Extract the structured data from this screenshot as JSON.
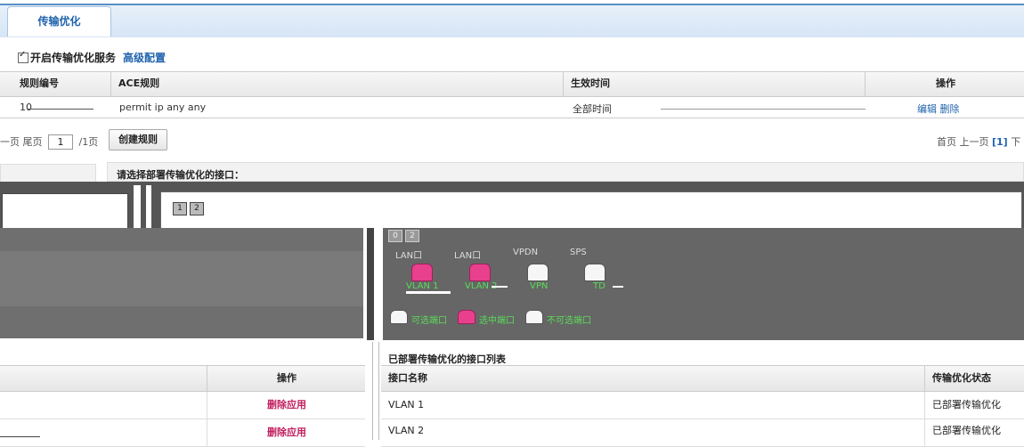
{
  "tabs": [
    {
      "label": "传输优化"
    }
  ],
  "service": {
    "checkbox_label": "开启传输优化服务",
    "advanced_link": "高级配置"
  },
  "rules_table": {
    "columns": [
      "规则编号",
      "ACE规则",
      "生效时间",
      "操作"
    ],
    "row": {
      "id": "10",
      "ace": "permit ip any any",
      "time": "全部时间",
      "actions": "编辑 删除"
    }
  },
  "pagination_left": {
    "prev": "一页",
    "last": "尾页",
    "page_value": "1",
    "total": "/1页"
  },
  "create_button": "创建规则",
  "pagination_right": {
    "first": "首页",
    "prev": "上一页",
    "current": "[1]",
    "next": "下"
  },
  "interface_panel": {
    "prompt": "请选择部署传输优化的接口：",
    "slot_labels_top": [
      "1",
      "2"
    ],
    "slot_labels_mid": [
      "0",
      "2"
    ],
    "group_labels": [
      "LAN口",
      "LAN口",
      "VPDN",
      "SPS"
    ],
    "ports": [
      {
        "label": "VLAN 1",
        "color": "#e8408c"
      },
      {
        "label": "VLAN 2",
        "color": "#e8408c"
      },
      {
        "label": "VPN",
        "color": "#f6f6f6"
      },
      {
        "label": "TD",
        "color": "#f6f6f6"
      }
    ],
    "legend": [
      "可选端口",
      "选中端口",
      "不可选端口"
    ]
  },
  "applied_table": {
    "column": "操作",
    "rows": [
      {
        "action": "删除应用"
      },
      {
        "action": "删除应用"
      }
    ]
  },
  "deployed_list": {
    "title": "已部署传输优化的接口列表",
    "columns": [
      "接口名称",
      "传输优化状态"
    ],
    "rows": [
      {
        "name": "VLAN 1",
        "status": "已部署传输优化"
      },
      {
        "name": "VLAN 2",
        "status": "已部署传输优化"
      }
    ]
  },
  "colors": {
    "accent": "#1f62ad",
    "selected_port": "#e8408c",
    "delete_link": "#c02060"
  }
}
